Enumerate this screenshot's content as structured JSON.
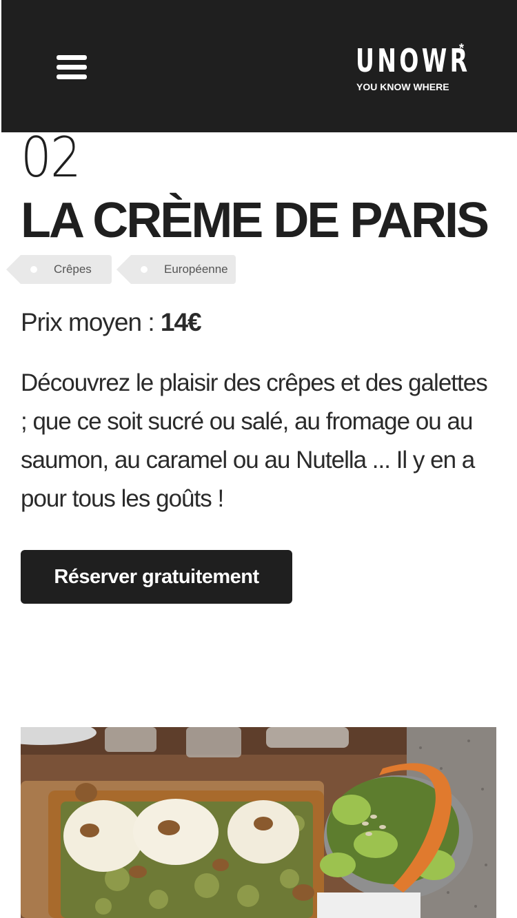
{
  "header": {
    "menu_icon": "hamburger-menu-icon",
    "logo": {
      "wordmark": "UNOWR",
      "star": "*",
      "tagline": "YOU KNOW WHERE"
    },
    "background": "#1f1f1f"
  },
  "restaurant": {
    "number": "02",
    "name": "LA CRÈME DE PARIS",
    "tags": [
      "Crêpes",
      "Européenne"
    ],
    "price_label": "Prix moyen : ",
    "price_value": "14€",
    "description": "Découvrez le plaisir des crêpes et des galettes ; que ce soit sucré ou salé, au fromage ou au saumon, au caramel ou au Nutella ... Il y en a pour tous les goûts !",
    "reserve_label": "Réserver gratuitement"
  },
  "photo": {
    "subject": "galette-with-goat-cheese-and-salad-image"
  },
  "colors": {
    "primary_dark": "#1f1f1f",
    "tag_background": "#e9e9e9",
    "text": "#2a2a2a"
  }
}
